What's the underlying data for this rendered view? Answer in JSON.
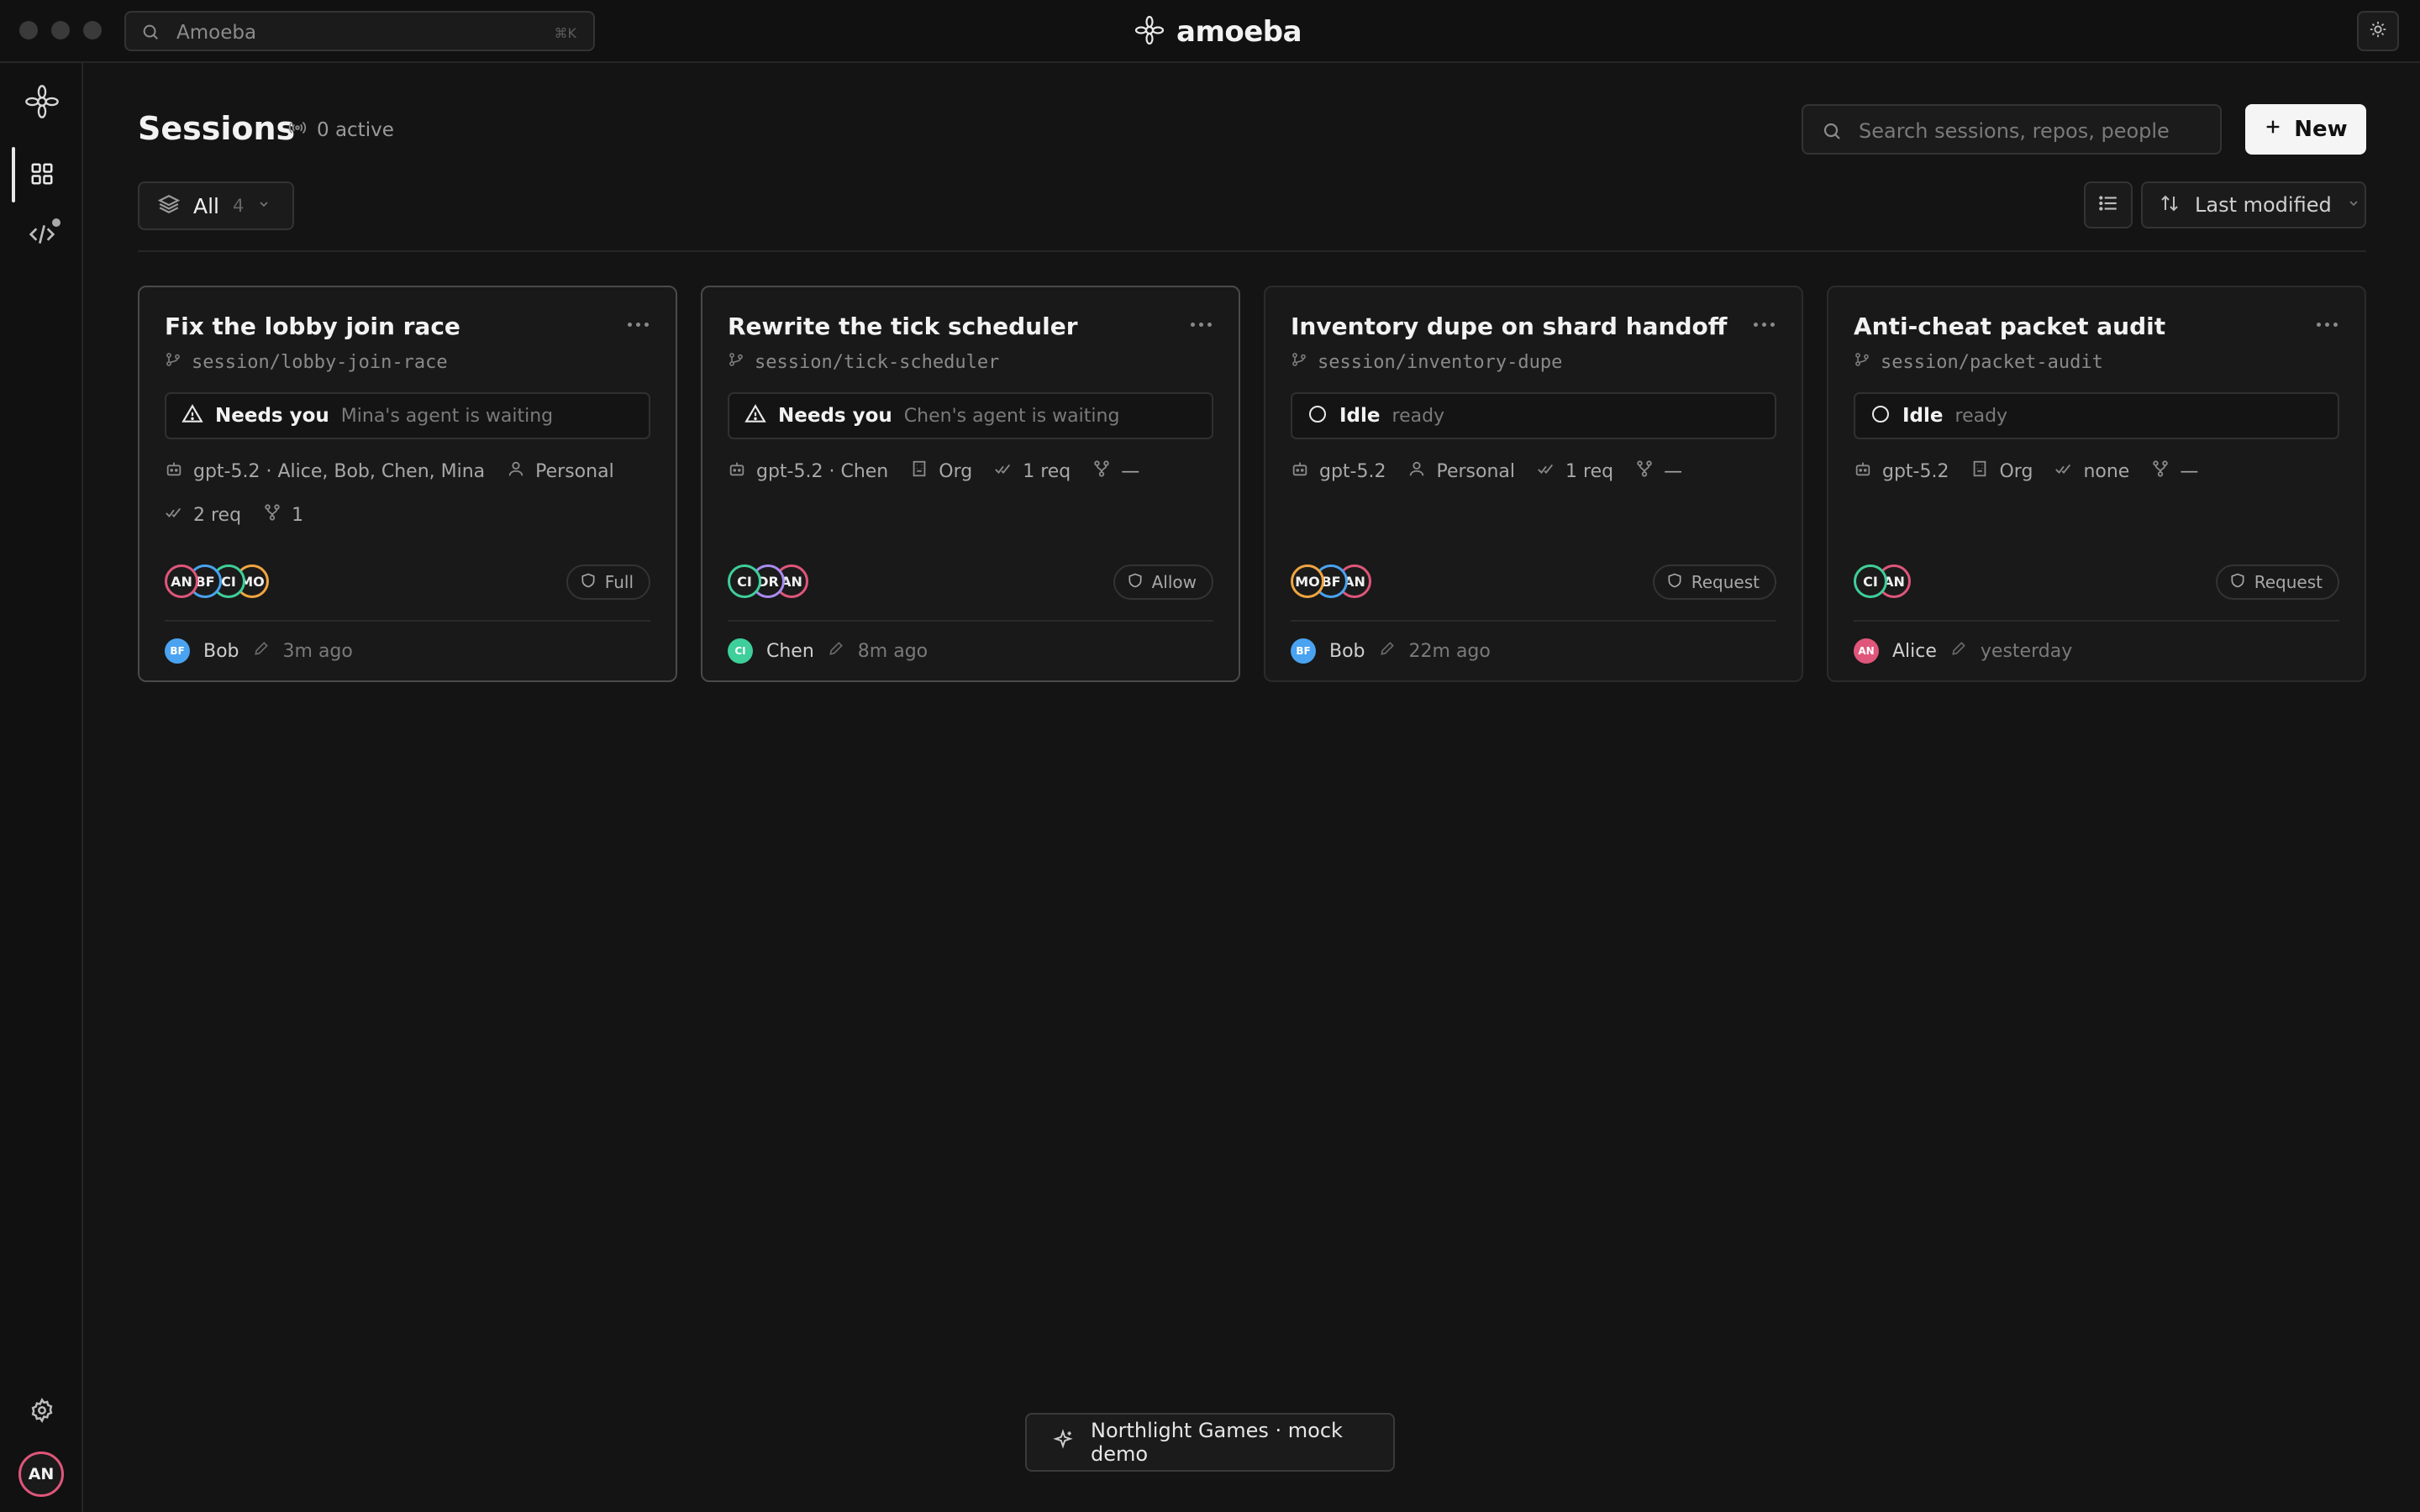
{
  "topbar": {
    "search_text": "Amoeba",
    "search_shortcut": "⌘K",
    "brand": "amoeba"
  },
  "rail": {
    "items": [
      "logo-icon",
      "grid-icon",
      "code-icon",
      "gear-icon"
    ],
    "user_initials": "AN"
  },
  "header": {
    "title": "Sessions",
    "active_count": "0 active",
    "search_placeholder": "Search sessions, repos, people",
    "new_label": "New"
  },
  "filters": {
    "scope_label": "All",
    "scope_count": "4",
    "sort_label": "Last modified"
  },
  "cards": [
    {
      "title": "Fix the lobby join race",
      "branch": "session/lobby-join-race",
      "status": "Needs you",
      "status_sub": "Mina's agent is waiting",
      "status_icon": "warning-icon",
      "model": "gpt-5.2 · Alice, Bob, Chen, Mina",
      "scope": "Personal",
      "reqs": "2 req",
      "forks": "1",
      "avatars": [
        {
          "initials": "AN",
          "color": "#e0567a"
        },
        {
          "initials": "BF",
          "color": "#4aa3f0"
        },
        {
          "initials": "CI",
          "color": "#3ecf9a"
        },
        {
          "initials": "MO",
          "color": "#f0a640"
        }
      ],
      "permission": "Full",
      "permission_icon": "shield-icon",
      "last_editor": {
        "initials": "BF",
        "name": "Bob",
        "color": "#4aa3f0"
      },
      "modified": "3m ago"
    },
    {
      "title": "Rewrite the tick scheduler",
      "branch": "session/tick-scheduler",
      "status": "Needs you",
      "status_sub": "Chen's agent is waiting",
      "status_icon": "warning-icon",
      "model": "gpt-5.2 · Chen",
      "scope": "Org",
      "reqs": "1 req",
      "forks": "—",
      "avatars": [
        {
          "initials": "CI",
          "color": "#3ecf9a"
        },
        {
          "initials": "DR",
          "color": "#a98bf0"
        },
        {
          "initials": "AN",
          "color": "#e0567a"
        }
      ],
      "permission": "Allow",
      "permission_icon": "shield-icon",
      "last_editor": {
        "initials": "CI",
        "name": "Chen",
        "color": "#3ecf9a"
      },
      "modified": "8m ago"
    },
    {
      "title": "Inventory dupe on shard handoff",
      "branch": "session/inventory-dupe",
      "status": "Idle",
      "status_sub": "ready",
      "status_icon": "circle-icon",
      "model": "gpt-5.2",
      "scope": "Personal",
      "reqs": "1 req",
      "forks": "—",
      "avatars": [
        {
          "initials": "MO",
          "color": "#f0a640"
        },
        {
          "initials": "BF",
          "color": "#4aa3f0"
        },
        {
          "initials": "AN",
          "color": "#e0567a"
        }
      ],
      "permission": "Request",
      "permission_icon": "shield-icon",
      "last_editor": {
        "initials": "BF",
        "name": "Bob",
        "color": "#4aa3f0"
      },
      "modified": "22m ago"
    },
    {
      "title": "Anti-cheat packet audit",
      "branch": "session/packet-audit",
      "status": "Idle",
      "status_sub": "ready",
      "status_icon": "circle-icon",
      "model": "gpt-5.2",
      "scope": "Org",
      "reqs": "none",
      "forks": "—",
      "avatars": [
        {
          "initials": "CI",
          "color": "#3ecf9a"
        },
        {
          "initials": "AN",
          "color": "#e0567a"
        }
      ],
      "permission": "Request",
      "permission_icon": "shield-icon",
      "last_editor": {
        "initials": "AN",
        "name": "Alice",
        "color": "#e0567a"
      },
      "modified": "yesterday"
    }
  ],
  "toast": {
    "text": "Northlight Games · mock demo"
  }
}
